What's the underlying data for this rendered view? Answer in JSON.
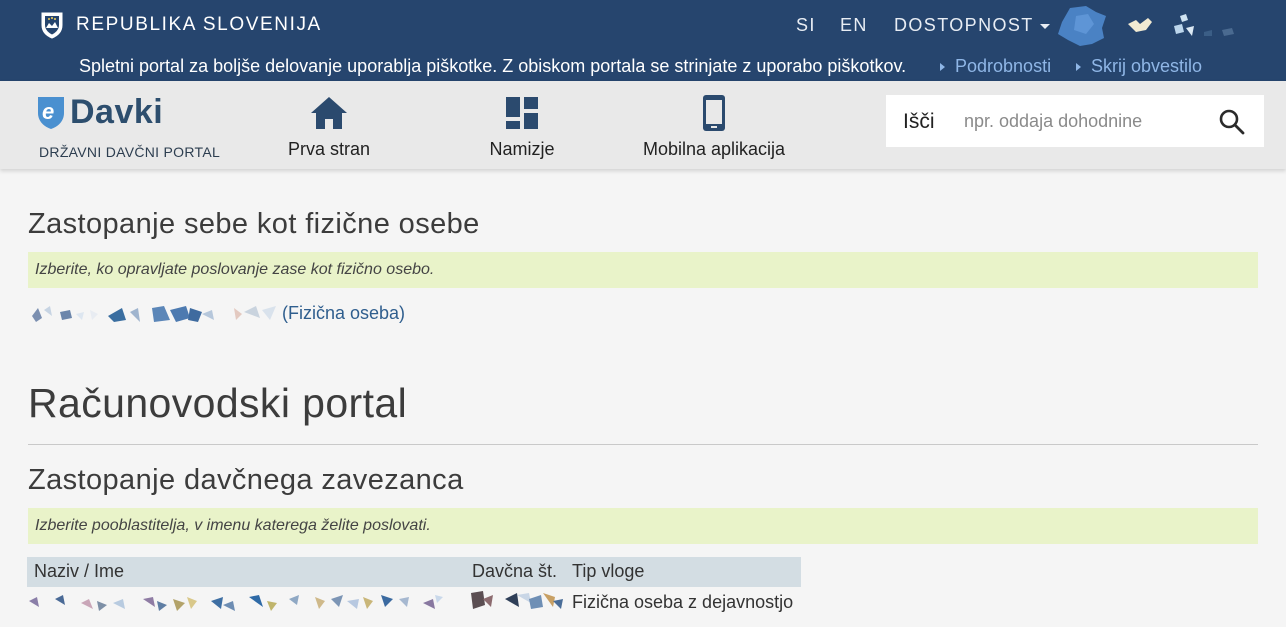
{
  "topbar": {
    "gov_name": "REPUBLIKA SLOVENIJA",
    "lang_si": "SI",
    "lang_en": "EN",
    "accessibility": "DOSTOPNOST",
    "cookie_text": "Spletni portal za boljše delovanje uporablja piškotke. Z obiskom portala se strinjate z uporabo piškotkov.",
    "cookie_details": "Podrobnosti",
    "cookie_hide": "Skrij obvestilo"
  },
  "header": {
    "logo_word": "Davki",
    "logo_sub": "DRŽAVNI DAVČNI PORTAL",
    "nav": [
      {
        "label": "Prva stran",
        "icon": "home-icon"
      },
      {
        "label": "Namizje",
        "icon": "dashboard-icon"
      },
      {
        "label": "Mobilna aplikacija",
        "icon": "mobile-phone-icon"
      }
    ],
    "search_label": "Išči",
    "search_placeholder": "npr. oddaja dohodnine"
  },
  "main": {
    "self_title": "Zastopanje sebe kot fizične osebe",
    "self_hint": "Izberite, ko opravljate poslovanje zase kot fizično osebo.",
    "self_person_suffix": "(Fizična oseba)",
    "accounting_title": "Računovodski portal",
    "represent_title": "Zastopanje davčnega zavezanca",
    "represent_hint": "Izberite pooblastitelja, v imenu katerega želite poslovati.",
    "table": {
      "headers": [
        "Naziv / Ime",
        "Davčna št.",
        "Tip vloge"
      ],
      "rows": [
        {
          "tip_vloge": "Fizična oseba z dejavnostjo"
        }
      ]
    }
  },
  "colors": {
    "topbar": "#26456e",
    "link": "#2f5e8e",
    "hint_bg": "#e9f3c9",
    "table_header_bg": "#d3dde3"
  }
}
